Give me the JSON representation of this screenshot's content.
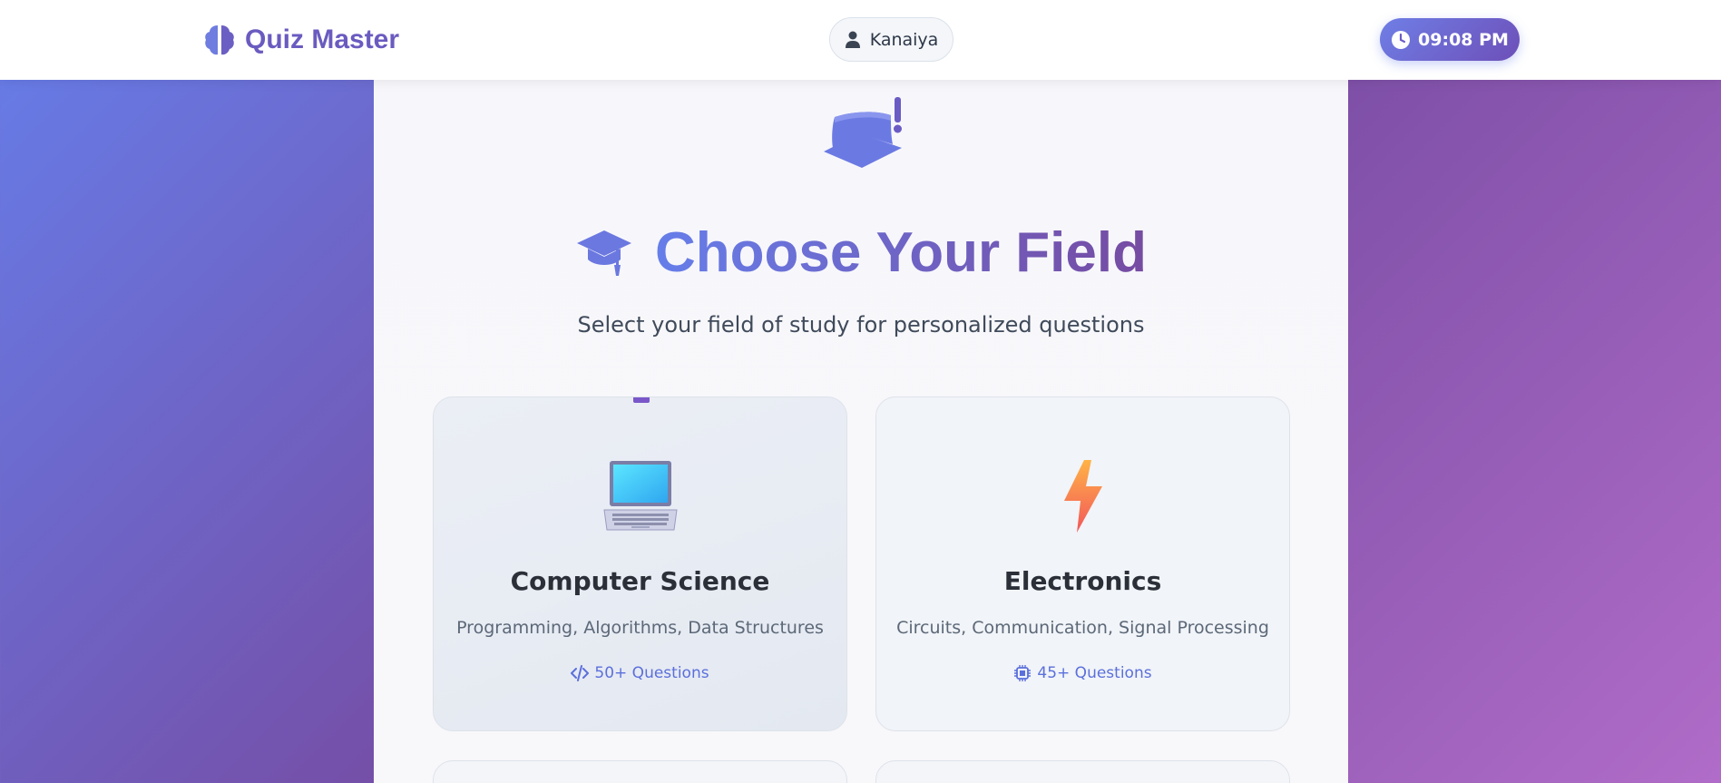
{
  "header": {
    "brand": {
      "name": "Quiz Master",
      "icon": "brain-icon"
    },
    "user": {
      "name": "Kanaiya",
      "icon": "user-icon"
    },
    "clock": {
      "time": "09:08 PM",
      "icon": "clock-icon"
    }
  },
  "main": {
    "hero_icon": "graduation-cap-icon",
    "title_icon": "graduation-cap-icon",
    "title": "Choose Your Field",
    "subtitle": "Select your field of study for personalized questions",
    "fields": [
      {
        "name": "Computer Science",
        "description": "Programming, Algorithms, Data Structures",
        "questions": "50+ Questions",
        "icon": "laptop-icon",
        "badge_icon": "code-icon",
        "selected": true
      },
      {
        "name": "Electronics",
        "description": "Circuits, Communication, Signal Processing",
        "questions": "45+ Questions",
        "icon": "lightning-icon",
        "badge_icon": "chip-icon",
        "selected": false
      }
    ]
  },
  "colors": {
    "accent": "#667eea",
    "accent_dark": "#764ba2",
    "text_dark": "#2a2f38",
    "text_muted": "#5c6878"
  }
}
